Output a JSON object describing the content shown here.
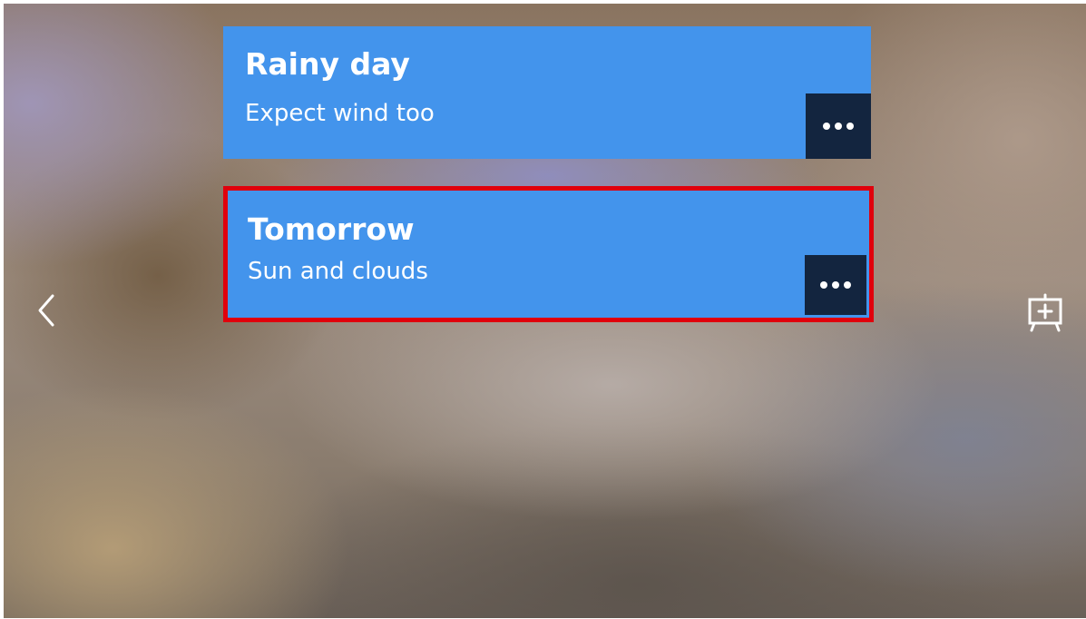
{
  "cards": [
    {
      "title": "Rainy day",
      "subtitle": "Expect wind too",
      "selected": false
    },
    {
      "title": "Tomorrow",
      "subtitle": "Sun and clouds",
      "selected": true
    }
  ],
  "nav": {
    "back_icon": "chevron-left-icon",
    "add_icon": "add-board-icon"
  },
  "colors": {
    "card": "#4394ec",
    "more_button": "#13253f",
    "selection": "#e0000c"
  }
}
